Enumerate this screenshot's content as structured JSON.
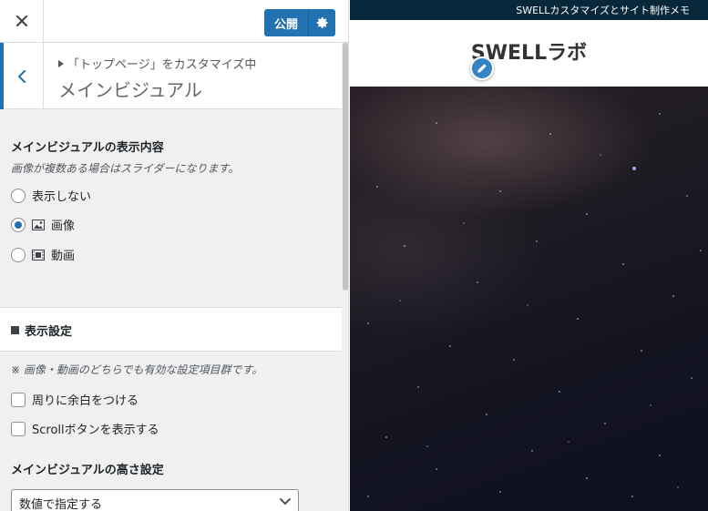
{
  "customizer": {
    "publish_label": "公開",
    "breadcrumb": "「トップページ」をカスタマイズ中",
    "section_title": "メインビジュアル",
    "display_content": {
      "title": "メインビジュアルの表示内容",
      "description": "画像が複数ある場合はスライダーになります。",
      "options": [
        {
          "label": "表示しない",
          "checked": false,
          "icon": ""
        },
        {
          "label": "画像",
          "checked": true,
          "icon": "image-icon"
        },
        {
          "label": "動画",
          "checked": false,
          "icon": "video-icon"
        }
      ]
    },
    "display_settings": {
      "title": "表示設定",
      "note": "※ 画像・動画のどちらでも有効な設定項目群です。",
      "checkboxes": [
        {
          "label": "周りに余白をつける",
          "checked": false
        },
        {
          "label": "Scrollボタンを表示する",
          "checked": false
        }
      ],
      "height_title": "メインビジュアルの高さ設定",
      "height_select_value": "数値で指定する"
    }
  },
  "preview": {
    "top_strip_text": "SWELLカスタマイズとサイト制作メモ",
    "site_title": "SWELLラボ",
    "colors": {
      "strip_bg": "#07273b",
      "accent": "#2271b1"
    }
  }
}
